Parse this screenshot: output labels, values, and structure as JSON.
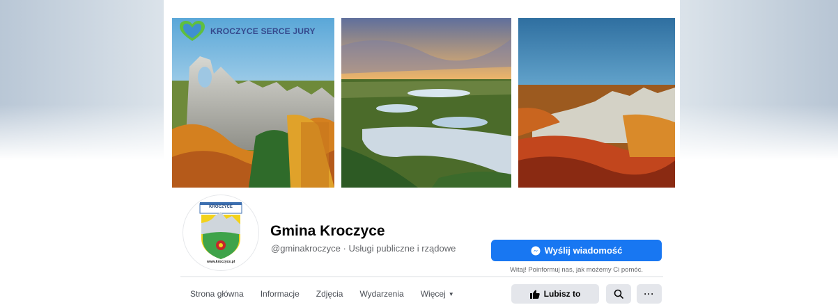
{
  "cover": {
    "banner_text": "KROCZYCE SERCE JURY"
  },
  "profile": {
    "crest_title": "KROCZYCE",
    "crest_url": "www.kroczyce.pl",
    "name": "Gmina Kroczyce",
    "subtitle": "@gminakroczyce · Usługi publiczne i rządowe"
  },
  "actions": {
    "message_label": "Wyślij wiadomość",
    "message_hint": "Witaj! Poinformuj nas, jak możemy Ci pomóc.",
    "like_label": "Lubisz to",
    "more_label": "···"
  },
  "tabs": [
    "Strona główna",
    "Informacje",
    "Zdjęcia",
    "Wydarzenia",
    "Więcej"
  ],
  "colors": {
    "primary": "#1877f2",
    "button_gray": "#e4e6eb",
    "text_primary": "#050505",
    "text_secondary": "#65676b"
  },
  "icons": {
    "message": "messenger-icon",
    "like": "thumbs-up-icon",
    "search": "search-icon",
    "more_caret": "caret-down-icon"
  }
}
